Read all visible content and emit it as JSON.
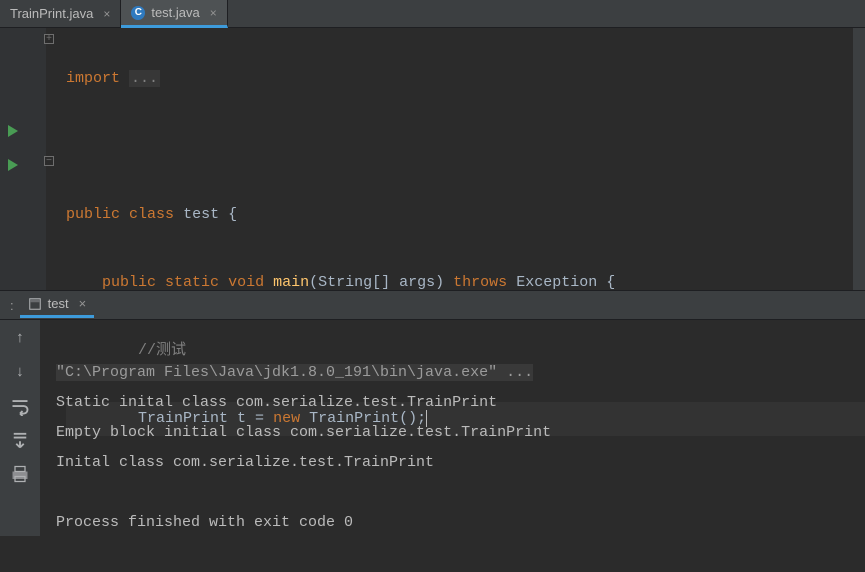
{
  "tabs": [
    {
      "label": "TrainPrint.java",
      "active": false
    },
    {
      "label": "test.java",
      "active": true
    }
  ],
  "code": {
    "line1_import": "import",
    "line1_ellipsis": "...",
    "line3_public": "public",
    "line3_class": "class",
    "line3_name": "test",
    "line3_brace": " {",
    "line4_public": "public",
    "line4_static": "static",
    "line4_void": "void",
    "line4_main": "main",
    "line4_args": "(String[] args)",
    "line4_throws": "throws",
    "line4_exc": "Exception",
    "line4_brace": " {",
    "line5_comment": "//测试",
    "line6_type": "TrainPrint",
    "line6_var": " t ",
    "line6_eq": "=",
    "line6_new": "new",
    "line6_ctor": "TrainPrint",
    "line6_paren": "();"
  },
  "tool": {
    "label_prefix": ":",
    "tab_label": "test"
  },
  "console": {
    "line1": "\"C:\\Program Files\\Java\\jdk1.8.0_191\\bin\\java.exe\" ...",
    "line2": "Static inital class com.serialize.test.TrainPrint",
    "line3": "Empty block initial class com.serialize.test.TrainPrint",
    "line4": "Inital class com.serialize.test.TrainPrint",
    "line5": "",
    "line6": "Process finished with exit code 0"
  }
}
